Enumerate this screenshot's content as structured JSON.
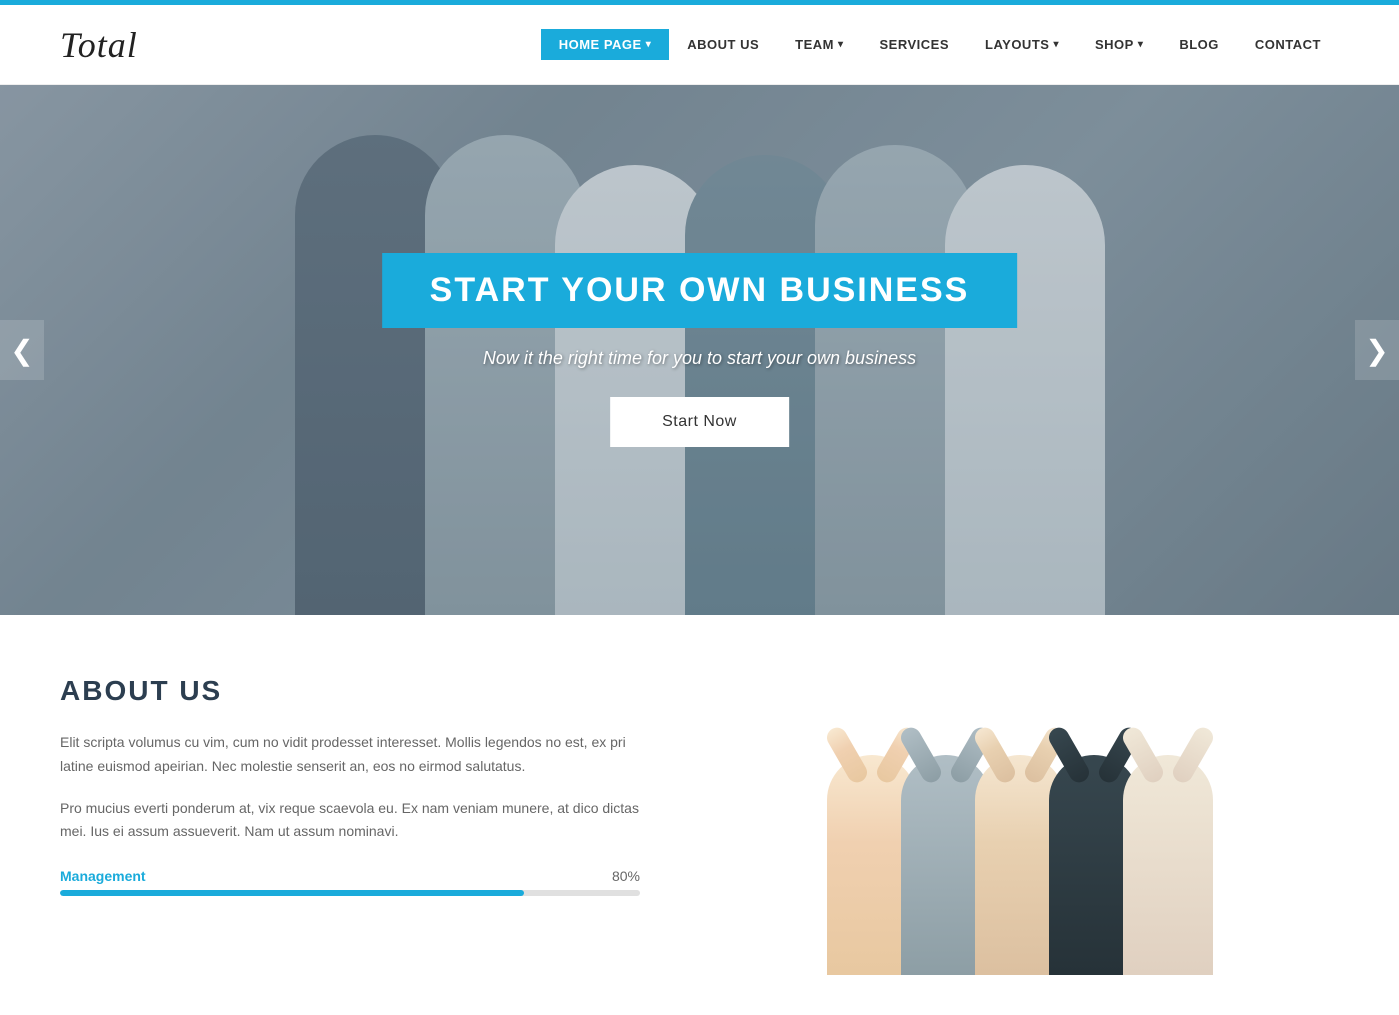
{
  "topbar": {},
  "header": {
    "logo": "Total",
    "nav": {
      "items": [
        {
          "id": "home-page",
          "label": "HOME PAGE",
          "active": true,
          "hasDropdown": true
        },
        {
          "id": "about-us",
          "label": "ABOUT US",
          "active": false,
          "hasDropdown": false
        },
        {
          "id": "team",
          "label": "TEAM",
          "active": false,
          "hasDropdown": true
        },
        {
          "id": "services",
          "label": "SERVICES",
          "active": false,
          "hasDropdown": false
        },
        {
          "id": "layouts",
          "label": "LAYOUTS",
          "active": false,
          "hasDropdown": true
        },
        {
          "id": "shop",
          "label": "SHOP",
          "active": false,
          "hasDropdown": true
        },
        {
          "id": "blog",
          "label": "BLOG",
          "active": false,
          "hasDropdown": false
        },
        {
          "id": "contact",
          "label": "CONTACT",
          "active": false,
          "hasDropdown": false
        }
      ]
    }
  },
  "hero": {
    "title": "START YOUR OWN BUSINESS",
    "subtitle": "Now it the right time for you to start your own business",
    "cta_label": "Start Now",
    "arrow_left": "❮",
    "arrow_right": "❯"
  },
  "about": {
    "title": "ABOUT US",
    "paragraph1": "Elit scripta volumus cu vim, cum no vidit prodesset interesset. Mollis legendos no est, ex pri latine euismod apeirian. Nec molestie senserit an, eos no eirmod salutatus.",
    "paragraph2": "Pro mucius everti ponderum at, vix reque scaevola eu. Ex nam veniam munere, at dico dictas mei. Ius ei assum assueverit. Nam ut assum nominavi.",
    "skill": {
      "label": "Management",
      "percent": 80,
      "percent_label": "80%"
    }
  },
  "colors": {
    "accent": "#1aabdb",
    "dark": "#2c3e50",
    "text": "#666"
  }
}
